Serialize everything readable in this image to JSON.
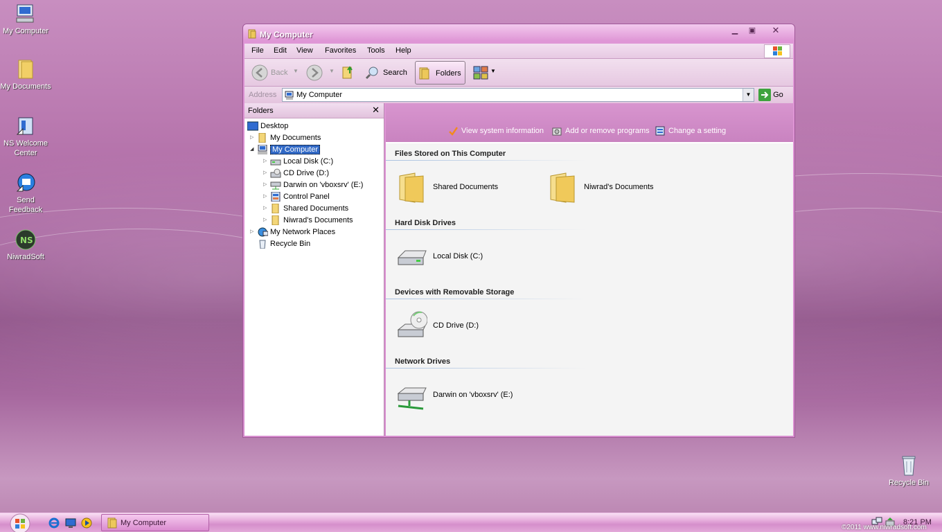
{
  "desktop": {
    "icons": [
      {
        "label": "My Computer"
      },
      {
        "label": "My Documents"
      },
      {
        "label": "NS Welcome Center"
      },
      {
        "label": "Send Feedback"
      },
      {
        "label": "NiwradSoft"
      },
      {
        "label": "Recycle Bin"
      }
    ]
  },
  "window": {
    "title": "My Computer",
    "menu": [
      "File",
      "Edit",
      "View",
      "Favorites",
      "Tools",
      "Help"
    ],
    "toolbar": {
      "back_label": "Back",
      "search_label": "Search",
      "folders_label": "Folders"
    },
    "address": {
      "label": "Address",
      "value": "My Computer",
      "go_label": "Go"
    },
    "folders_pane": {
      "title": "Folders",
      "tree": [
        {
          "label": "Desktop"
        },
        {
          "label": "My Documents"
        },
        {
          "label": "My Computer"
        },
        {
          "label": "Local Disk (C:)"
        },
        {
          "label": "CD Drive (D:)"
        },
        {
          "label": "Darwin on 'vboxsrv' (E:)"
        },
        {
          "label": "Control Panel"
        },
        {
          "label": "Shared Documents"
        },
        {
          "label": "Niwrad's Documents"
        },
        {
          "label": "My Network Places"
        },
        {
          "label": "Recycle Bin"
        }
      ]
    },
    "tasks": [
      {
        "label": "View system information"
      },
      {
        "label": "Add or remove programs"
      },
      {
        "label": "Change a setting"
      }
    ],
    "groups": [
      {
        "title": "Files Stored on This Computer",
        "items": [
          "Shared Documents",
          "Niwrad's Documents"
        ]
      },
      {
        "title": "Hard Disk Drives",
        "items": [
          "Local Disk (C:)"
        ]
      },
      {
        "title": "Devices with Removable Storage",
        "items": [
          "CD Drive (D:)"
        ]
      },
      {
        "title": "Network Drives",
        "items": [
          "Darwin on 'vboxsrv' (E:)"
        ]
      }
    ]
  },
  "taskbar": {
    "task_button_label": "My Computer",
    "clock": "8:21 PM",
    "watermark": "©2011 www.niwradsoft.com"
  },
  "colors": {
    "accent": "#d58fcb",
    "selection": "#3169c6"
  }
}
